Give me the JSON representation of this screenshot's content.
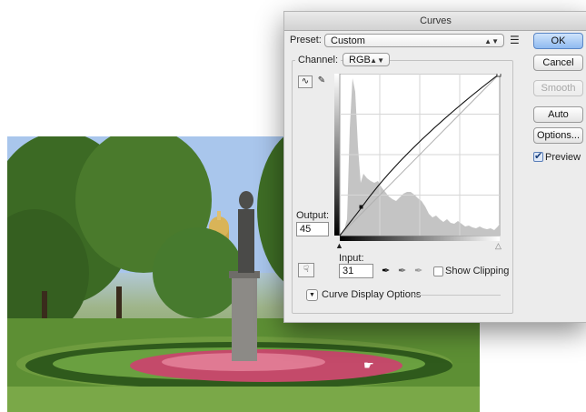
{
  "dialog": {
    "title": "Curves",
    "preset_label": "Preset:",
    "preset_value": "Custom",
    "preset_menu_icon": "list-menu-icon",
    "channel_label": "Channel:",
    "channel_value": "RGB",
    "output_label": "Output:",
    "output_value": "45",
    "input_label": "Input:",
    "input_value": "31",
    "show_clipping_label": "Show Clipping",
    "show_clipping_checked": false,
    "curve_display_options_label": "Curve Display Options",
    "buttons": {
      "ok": "OK",
      "cancel": "Cancel",
      "smooth": "Smooth",
      "auto": "Auto",
      "options": "Options..."
    },
    "preview_label": "Preview",
    "preview_checked": true,
    "curve_point": {
      "input": 31,
      "output": 45
    },
    "icons": [
      "curve-point-tool-icon",
      "pencil-tool-icon",
      "target-adjust-icon",
      "black-eyedropper-icon",
      "gray-eyedropper-icon",
      "white-eyedropper-icon",
      "disclosure-arrow-icon",
      "black-point-slider-icon",
      "white-point-slider-icon"
    ]
  },
  "colors": {
    "ok_button": "#8fbaf0",
    "histogram": "#c4c4c4",
    "dialog_bg": "#ececec"
  }
}
